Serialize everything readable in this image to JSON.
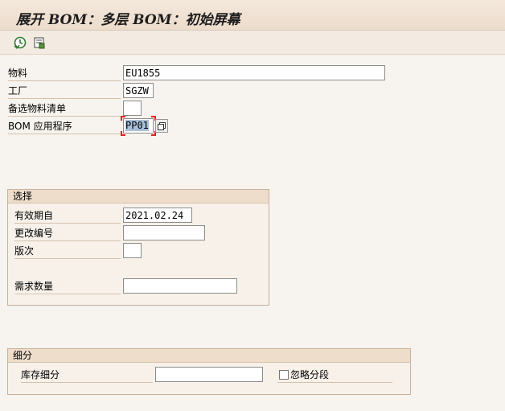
{
  "window": {
    "title": "展开 BOM：多层 BOM：初始屏幕"
  },
  "toolbar": {
    "execute_icon": "execute-clock-icon",
    "variant_icon": "get-variant-icon"
  },
  "header_fields": {
    "material_label": "物料",
    "material_value": "EU1855",
    "plant_label": "工厂",
    "plant_value": "SGZW",
    "alt_bom_label": "备选物料清单",
    "alt_bom_value": "",
    "bom_app_label": "BOM 应用程序",
    "bom_app_value": "PP01"
  },
  "selection": {
    "title": "选择",
    "valid_from_label": "有效期自",
    "valid_from_value": "2021.02.24",
    "change_number_label": "更改编号",
    "change_number_value": "",
    "revision_label": "版次",
    "revision_value": "",
    "required_qty_label": "需求数量",
    "required_qty_value": ""
  },
  "breakdown": {
    "title": "细分",
    "storage_label": "库存细分",
    "storage_value": "",
    "ignore_segment_label": "忽略分段",
    "ignore_segment_checked": false
  }
}
